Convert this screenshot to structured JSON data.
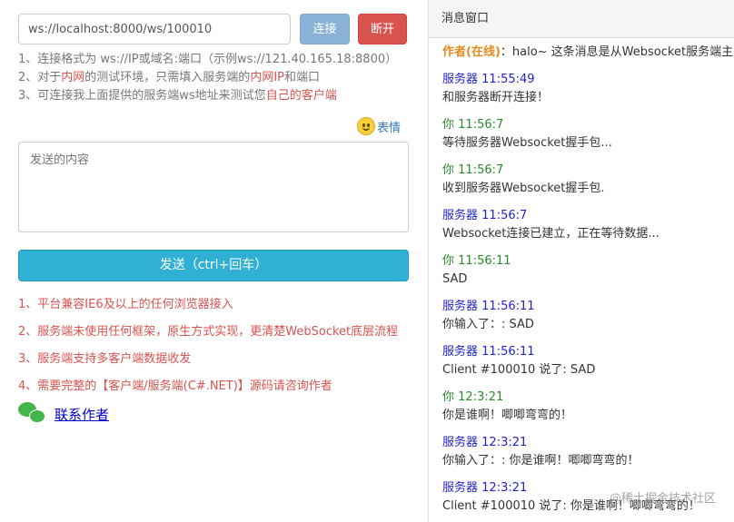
{
  "connection": {
    "url_value": "ws://localhost:8000/ws/100010",
    "connect_label": "连接",
    "disconnect_label": "断开"
  },
  "hints": {
    "line1": "1、连接格式为 ws://IP或域名:端口（示例ws://121.40.165.18:8800）",
    "line2_a": "2、对于",
    "line2_b": "内网",
    "line2_c": "的测试环境，只需填入服务端的",
    "line2_d": "内网IP",
    "line2_e": "和端口",
    "line3_a": "3、可连接我上面提供的服务端ws地址来测试您",
    "line3_b": "自己的客户端"
  },
  "emoji": {
    "label": "表情",
    "icon": "smiley-icon"
  },
  "composer": {
    "placeholder": "发送的内容",
    "send_label": "发送（ctrl+回车）"
  },
  "features": [
    "1、平台兼容IE6及以上的任何浏览器接入",
    "2、服务端未使用任何框架，原生方式实现，更清楚WebSocket底层流程",
    "3、服务端支持多客户端数据收发",
    "4、需要完整的【客户端/服务端(C#.NET)】源码请咨询作者"
  ],
  "contact": {
    "label": "联系作者",
    "icon": "wechat-icon"
  },
  "panel": {
    "title": "消息窗口",
    "author_tag": "作者(在线)",
    "author_message": "：halo~ 这条消息是从Websocket服务端主",
    "entries": [
      {
        "sender": "服务器",
        "time": "11:55:49",
        "kind": "server",
        "text": "和服务器断开连接！"
      },
      {
        "sender": "你",
        "time": "11:56:7",
        "kind": "you",
        "text": "等待服务器Websocket握手包..."
      },
      {
        "sender": "你",
        "time": "11:56:7",
        "kind": "you",
        "text": "收到服务器Websocket握手包."
      },
      {
        "sender": "服务器",
        "time": "11:56:7",
        "kind": "server",
        "text": "Websocket连接已建立，正在等待数据..."
      },
      {
        "sender": "你",
        "time": "11:56:11",
        "kind": "you",
        "text": "SAD"
      },
      {
        "sender": "服务器",
        "time": "11:56:11",
        "kind": "server",
        "text": "你输入了：: SAD"
      },
      {
        "sender": "服务器",
        "time": "11:56:11",
        "kind": "server",
        "text": "Client #100010 说了: SAD"
      },
      {
        "sender": "你",
        "time": "12:3:21",
        "kind": "you",
        "text": "你是谁啊！唧唧弯弯的！"
      },
      {
        "sender": "服务器",
        "time": "12:3:21",
        "kind": "server",
        "text": "你输入了：: 你是谁啊！唧唧弯弯的！"
      },
      {
        "sender": "服务器",
        "time": "12:3:21",
        "kind": "server",
        "text": "Client #100010 说了: 你是谁啊！唧唧弯弯的！"
      }
    ]
  },
  "watermark": "@稀土掘金技术社区",
  "colors": {
    "connect": "#8ab2d6",
    "disconnect": "#d9534f",
    "send": "#31b0d5",
    "server": "#2222cc",
    "you": "#2a8a2a",
    "author": "#e38a1e"
  }
}
